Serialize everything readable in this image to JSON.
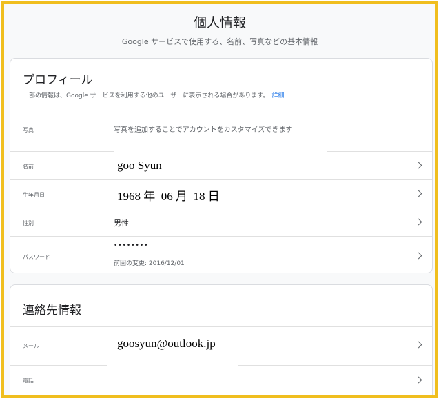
{
  "header": {
    "title": "個人情報",
    "subtitle": "Google サービスで使用する、名前、写真などの基本情報"
  },
  "profile": {
    "title": "プロフィール",
    "description": "一部の情報は、Google サービスを利用する他のユーザーに表示される場合があります。",
    "details_link": "詳細",
    "rows": {
      "photo": {
        "label": "写真",
        "value": "写真を追加することでアカウントをカスタマイズできます"
      },
      "name": {
        "label": "名前",
        "value": "goo Syun"
      },
      "birthday": {
        "label": "生年月日",
        "value": "1968 年  06 月  18 日"
      },
      "gender": {
        "label": "性別",
        "value": "男性"
      },
      "password": {
        "label": "パスワード",
        "value": "••••••••",
        "sub": "前回の変更: 2016/12/01"
      }
    }
  },
  "contact": {
    "title": "連絡先情報",
    "rows": {
      "email": {
        "label": "メール",
        "value": "goosyun@outlook.jp"
      },
      "phone": {
        "label": "電話",
        "value": ""
      }
    }
  },
  "icons": {
    "row_arrow": "chevron-right-icon"
  },
  "colors": {
    "frame_border": "#f0be1e",
    "link": "#1a73e8",
    "background": "#f8f9fa"
  }
}
